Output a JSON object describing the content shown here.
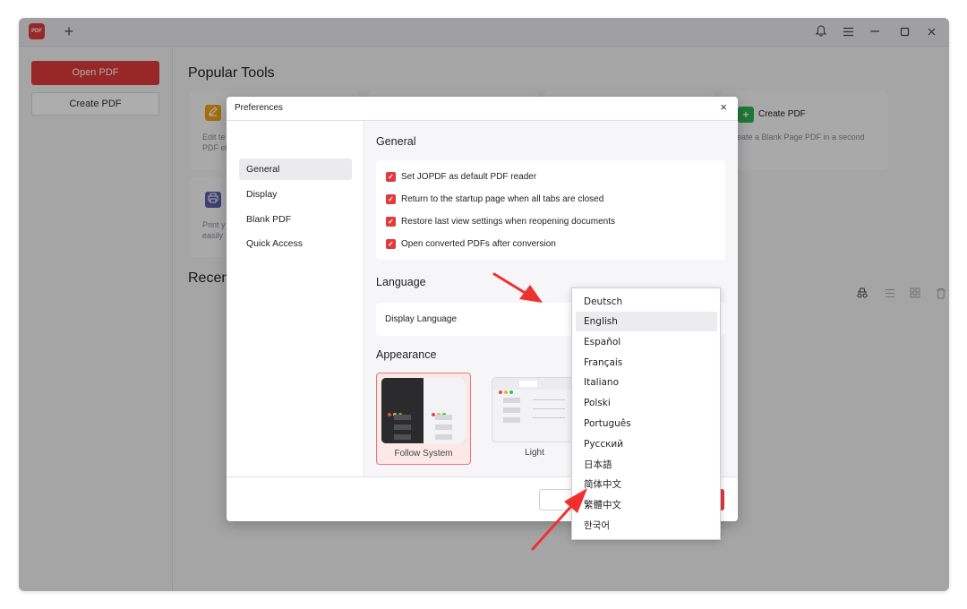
{
  "app": {
    "logo_text": "PDF",
    "new_tab_glyph": "+",
    "window_controls": [
      "bell-icon",
      "menu-icon",
      "minimize-icon",
      "maximize-icon",
      "close-icon"
    ],
    "accent_color": "#e03a3a"
  },
  "sidebar": {
    "open_pdf": "Open PDF",
    "create_pdf": "Create PDF"
  },
  "main": {
    "popular_title": "Popular Tools",
    "recent_title": "Recen",
    "tools": [
      {
        "desc_line1": "Edit te",
        "desc_line2": "PDF ef",
        "icon": "edit-icon",
        "color": "#f2a313"
      },
      {
        "desc_line1": "Print y",
        "desc_line2": "easily",
        "icon": "printer-icon",
        "color": "#5b5fa8"
      },
      {
        "name": "Create PDF",
        "desc": "eate a Blank Page PDF in a second",
        "icon": "plus-icon",
        "color": "#2fb351"
      }
    ],
    "view_icons": [
      "incognito-icon",
      "list-view-icon",
      "grid-view-icon",
      "delete-icon"
    ]
  },
  "dialog": {
    "title": "Preferences",
    "close_glyph": "×",
    "nav": [
      "General",
      "Display",
      "Blank PDF",
      "Quick Access"
    ],
    "active_nav": "General",
    "general": {
      "title": "General",
      "options": [
        {
          "label": "Set JOPDF as default PDF reader",
          "checked": true
        },
        {
          "label": "Return to the startup page when all tabs are closed",
          "checked": true
        },
        {
          "label": "Restore last view settings when reopening documents",
          "checked": true
        },
        {
          "label": "Open converted PDFs after conversion",
          "checked": true
        }
      ]
    },
    "language": {
      "title": "Language",
      "display_language_label": "Display Language",
      "selected": "English"
    },
    "appearance": {
      "title": "Appearance",
      "options": [
        "Follow System",
        "Light"
      ],
      "selected": "Follow System"
    }
  },
  "language_dropdown": {
    "options": [
      "Deutsch",
      "English",
      "Español",
      "Français",
      "Italiano",
      "Polski",
      "Português",
      "Русский",
      "日本語",
      "简体中文",
      "繁體中文",
      "한국어"
    ],
    "selected": "English"
  }
}
